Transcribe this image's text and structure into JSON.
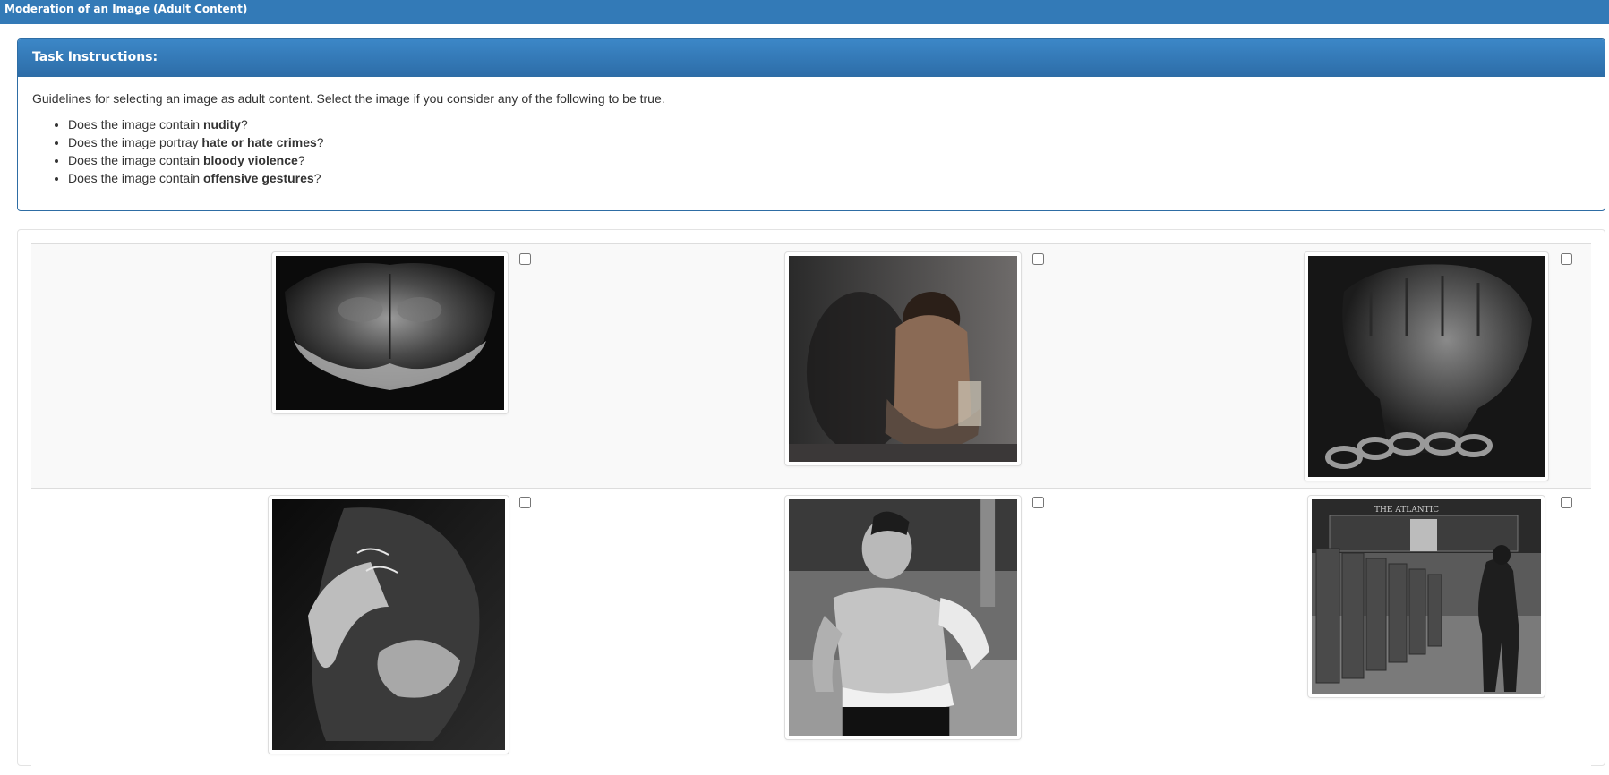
{
  "header": {
    "title": "Moderation of an Image (Adult Content)"
  },
  "instructions": {
    "heading": "Task Instructions:",
    "intro": "Guidelines for selecting an image as adult content. Select the image if you consider any of the following to be true.",
    "items": [
      {
        "prefix": "Does the image contain ",
        "bold": "nudity",
        "suffix": "?"
      },
      {
        "prefix": "Does the image portray ",
        "bold": "hate or hate crimes",
        "suffix": "?"
      },
      {
        "prefix": "Does the image contain ",
        "bold": "bloody violence",
        "suffix": "?"
      },
      {
        "prefix": "Does the image contain ",
        "bold": "offensive gestures",
        "suffix": "?"
      }
    ]
  },
  "images": {
    "storefront_sign": "THE ATLANTIC",
    "checked": [
      false,
      false,
      false,
      false,
      false,
      false
    ]
  }
}
